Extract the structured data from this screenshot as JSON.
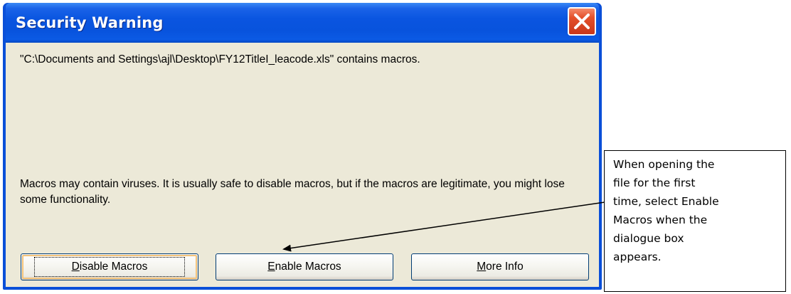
{
  "dialog": {
    "title": "Security Warning",
    "close_icon": "close-icon",
    "message": "\"C:\\Documents and Settings\\ajl\\Desktop\\FY12TitleI_leacode.xls\" contains macros.",
    "warning": "Macros may contain viruses. It is usually safe to disable macros, but if the macros are legitimate, you might lose some functionality.",
    "buttons": {
      "disable_prefix": "D",
      "disable_rest": "isable Macros",
      "enable_prefix": "E",
      "enable_rest": "nable Macros",
      "more_prefix": "M",
      "more_rest": "ore Info"
    }
  },
  "callout": {
    "text": "When opening the file for the first time, select Enable Macros when the dialogue box appears."
  },
  "colors": {
    "title_bar": "#0853dd",
    "client_bg": "#ece9d8",
    "close_button": "#e4502a"
  }
}
